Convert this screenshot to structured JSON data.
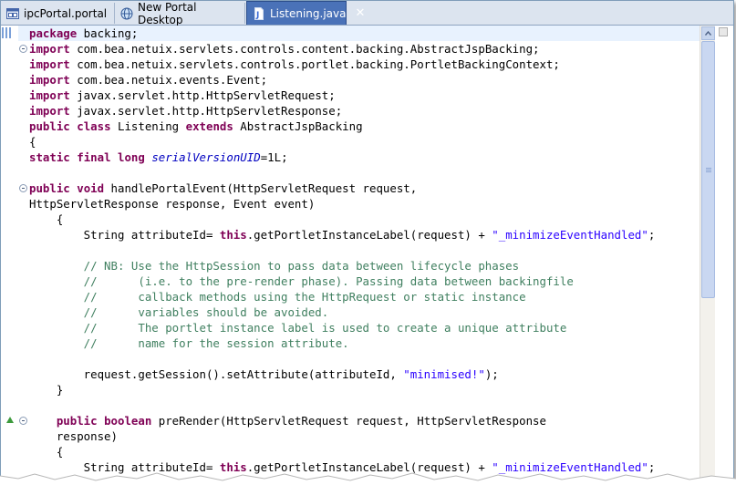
{
  "tabs": [
    {
      "label": "ipcPortal.portal",
      "icon": "portal-file-icon",
      "active": false
    },
    {
      "label": "New Portal Desktop",
      "icon": "globe-icon",
      "active": false
    },
    {
      "label": "Listening.java",
      "icon": "java-file-icon",
      "active": true,
      "close": "✕"
    }
  ],
  "code": {
    "l1": {
      "k": "package",
      "t": " backing;"
    },
    "l2": {
      "k": "import",
      "t": " com.bea.netuix.servlets.controls.content.backing.AbstractJspBacking;"
    },
    "l3": {
      "k": "import",
      "t": " com.bea.netuix.servlets.controls.portlet.backing.PortletBackingContext;"
    },
    "l4": {
      "k": "import",
      "t": " com.bea.netuix.events.Event;"
    },
    "l5": {
      "k": "import",
      "t": " javax.servlet.http.HttpServletRequest;"
    },
    "l6": {
      "k": "import",
      "t": " javax.servlet.http.HttpServletResponse;"
    },
    "l7": {
      "k1": "public",
      "k2": "class",
      "t1": " Listening ",
      "k3": "extends",
      "t2": " AbstractJspBacking"
    },
    "l8": {
      "t": "{"
    },
    "l9": {
      "k1": "static",
      "k2": "final",
      "k3": "long",
      "f": "serialVersionUID",
      "t": "=1L;"
    },
    "l10": {
      "k1": "public",
      "k2": "void",
      "t": " handlePortalEvent(HttpServletRequest request,"
    },
    "l11": {
      "t": "HttpServletResponse response, Event event)"
    },
    "l12": {
      "t": "    {"
    },
    "l13": {
      "t1": "        String attributeId= ",
      "k": "this",
      "t2": ".getPortletInstanceLabel(request) + ",
      "s": "\"_minimizeEventHandled\"",
      "t3": ";"
    },
    "l14": {
      "c": "        // NB: Use the HttpSession to pass data between lifecycle phases"
    },
    "l15": {
      "c": "        //      (i.e. to the pre-render phase). Passing data between backingfile"
    },
    "l16": {
      "c": "        //      callback methods using the HttpRequest or static instance"
    },
    "l17": {
      "c": "        //      variables should be avoided."
    },
    "l18": {
      "c": "        //      The portlet instance label is used to create a unique attribute"
    },
    "l19": {
      "c": "        //      name for the session attribute."
    },
    "l20": {
      "t1": "        request.getSession().setAttribute(attributeId, ",
      "s": "\"minimised!\"",
      "t2": ");"
    },
    "l21": {
      "t": "    }"
    },
    "l22": {
      "k1": "public",
      "k2": "boolean",
      "t": " preRender(HttpServletRequest request, HttpServletResponse"
    },
    "l23": {
      "t": "    response)"
    },
    "l24": {
      "t": "    {"
    },
    "l25": {
      "t1": "        String attributeId= ",
      "k": "this",
      "t2": ".getPortletInstanceLabel(request) + ",
      "s": "\"_minimizeEventHandled\"",
      "t3": ";"
    }
  },
  "colors": {
    "keyword": "#7f0055",
    "string": "#2a00ff",
    "comment": "#3f7f5f",
    "field": "#0000c0",
    "active_tab": "#4a72b8"
  }
}
